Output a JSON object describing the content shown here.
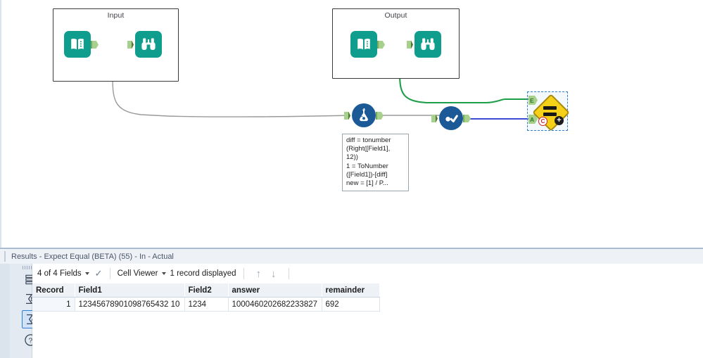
{
  "canvas": {
    "containers": [
      {
        "title": "Input",
        "icons": {
          "left": "book-icon",
          "right": "binoculars-icon"
        }
      },
      {
        "title": "Output",
        "icons": {
          "left": "book-icon",
          "right": "binoculars-icon"
        }
      }
    ],
    "tools": [
      {
        "name": "formula-tool",
        "icon": "flask-icon"
      },
      {
        "name": "select-tool",
        "icon": "check-circle-icon"
      },
      {
        "name": "expect-equal-tool",
        "icon": "equals-diamond-icon",
        "selected": true,
        "anchors": {
          "expected": "E",
          "actual": "A"
        },
        "badges": {
          "error": "C",
          "add": "+"
        }
      }
    ],
    "formula_note": "diff = tonumber\n(Right([Field1],\n12))\n1 = ToNumber\n([Field1])-[diff]\nnew = [1] / P...",
    "colors": {
      "teal": "#0f9e8e",
      "blue": "#1b5a96",
      "yellow": "#f5d019",
      "green_wire": "#1f9e4a",
      "blue_wire": "#2030d0",
      "gray_wire": "#8c8c8c",
      "anchor_green": "#a8d08d"
    }
  },
  "results": {
    "title": "Results - Expect Equal (BETA) (55) - In - Actual",
    "rail": [
      {
        "name": "table-view-icon",
        "label": "",
        "selected": false
      },
      {
        "name": "sigma-e-icon",
        "label": "E",
        "selected": false
      },
      {
        "name": "sigma-a-icon",
        "label": "A",
        "selected": true
      },
      {
        "name": "help-icon",
        "label": "?",
        "selected": false
      }
    ],
    "toolbar": {
      "fields_label": "4 of 4 Fields",
      "check_icon": "checkmark-icon",
      "viewer_label": "Cell Viewer",
      "record_count_label": "1 record displayed",
      "up_arrow": "↑",
      "down_arrow": "↓"
    },
    "table": {
      "columns": [
        "Record",
        "Field1",
        "Field2",
        "answer",
        "remainder"
      ],
      "rows": [
        {
          "Record": "1",
          "Field1": "12345678901098765432 10",
          "Field2": "1234",
          "answer": "1000460202682233827",
          "remainder": "692"
        }
      ]
    }
  }
}
